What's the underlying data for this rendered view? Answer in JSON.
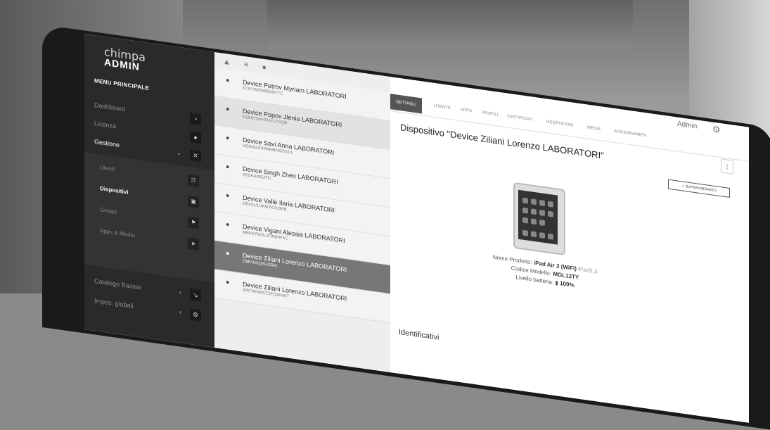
{
  "brand": {
    "line1": "chimpa",
    "line2": "ADMIN"
  },
  "menu": {
    "header": "MENU PRINCIPALE",
    "items": [
      {
        "label": "Dashboard",
        "icon": "dashboard-icon",
        "glyph": "◔"
      },
      {
        "label": "Licenza",
        "icon": "license-icon",
        "glyph": "●"
      },
      {
        "label": "Gestione",
        "icon": "wrench-icon",
        "glyph": "✕",
        "caret": "⌄"
      }
    ],
    "subitems": [
      {
        "label": "Utenti",
        "glyph": "☷"
      },
      {
        "label": "Dispositivi",
        "glyph": "▣"
      },
      {
        "label": "Gruppi",
        "glyph": "⚑"
      },
      {
        "label": "Apps & Media",
        "glyph": "➤",
        "caret": "‹"
      }
    ],
    "lower": [
      {
        "label": "Catalogo Bazaar",
        "glyph": "↘",
        "caret": "‹"
      },
      {
        "label": "Impos. globali",
        "glyph": "⚙",
        "caret": "‹"
      }
    ]
  },
  "toolbar": {
    "icons": "▲ ≡ ●"
  },
  "devices": [
    {
      "name": "Device Petrov Myriam LABORATORI",
      "serial": "FC8YW85480UBYTC"
    },
    {
      "name": "Device Popov Jlenia LABORATORI",
      "serial": "NZ6ICYWHFUYLYSQO"
    },
    {
      "name": "Device Savi Anna LABORATORI",
      "serial": "VGWGUGRWMBNSGST4"
    },
    {
      "name": "Device Singh Zhen LABORATORI",
      "serial": "A5DKAIN5JTD"
    },
    {
      "name": "Device Valle Ilaria LABORATORI",
      "serial": "DE4SU1UKM2K2LBKB"
    },
    {
      "name": "Device Vigani Alessia LABORATORI",
      "serial": "MBKB7MOLJF9GKRSC"
    },
    {
      "name": "Device Ziliani Lorenzo LABORATORI",
      "serial": "DMFKKIQ5GG5KI"
    },
    {
      "name": "Device Ziliani Lorenzo LABORATORI",
      "serial": "W8T9K6WCCIFQWI4KT"
    }
  ],
  "tabs": [
    "DETTAGLI",
    "UTENTE",
    "APPS",
    "PROFILI",
    "CERTIFICATI",
    "RESTRIZIONI",
    "MEDIA",
    "AGGIORNAMEN"
  ],
  "header": {
    "admin": "Admin",
    "more": "⋮"
  },
  "detail": {
    "title": "Dispositivo \"Device Ziliani Lorenzo LABORATORI\"",
    "badge": "✓ SUPERVISIONATO",
    "product_label": "Nome Prodotto:",
    "product_value": "iPad Air 2 (WiFi)",
    "product_code": "iPad5,3",
    "model_label": "Codice Modello:",
    "model_value": "MGL12TY",
    "battery_label": "Livello batteria:",
    "battery_value": "100%",
    "section": "Identificativi"
  }
}
